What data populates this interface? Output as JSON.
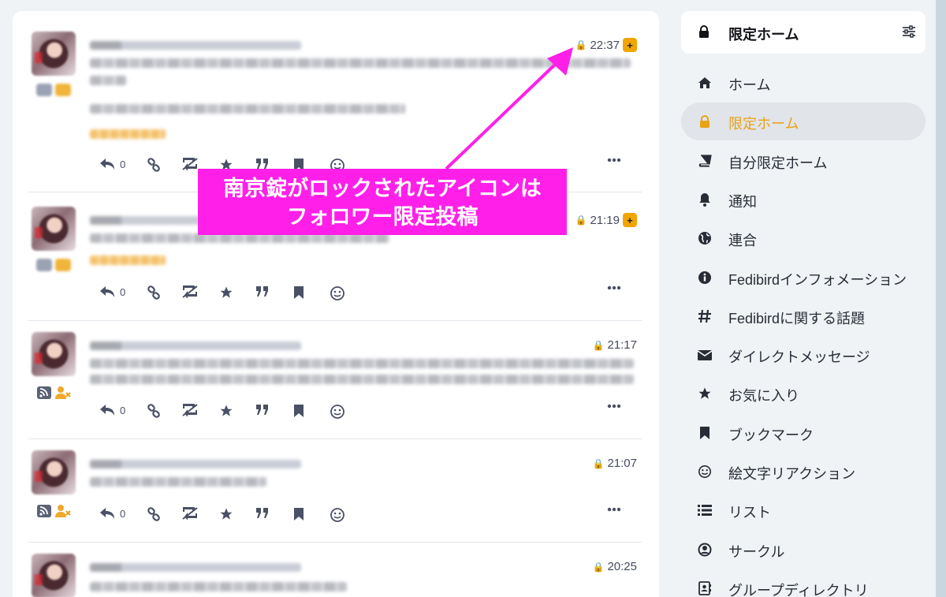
{
  "timeline": {
    "statuses": [
      {
        "time": "22:37",
        "plus_badge": "+",
        "reply_count": "0"
      },
      {
        "time": "21:19",
        "plus_badge": "+",
        "reply_count": "0"
      },
      {
        "time": "21:17",
        "reply_count": "0"
      },
      {
        "time": "21:07",
        "reply_count": "0"
      },
      {
        "time": "20:25"
      }
    ]
  },
  "annotation": {
    "line1": "南京錠がロックされたアイコンは",
    "line2": "フォロワー限定投稿",
    "color": "#ff1fe8"
  },
  "sidebar": {
    "header": {
      "title": "限定ホーム",
      "icon": "lock-icon",
      "settings_icon": "sliders-icon"
    },
    "items": [
      {
        "label": "ホーム",
        "icon": "home-icon"
      },
      {
        "label": "限定ホーム",
        "icon": "lock-icon",
        "active": true
      },
      {
        "label": "自分限定ホーム",
        "icon": "book-icon"
      },
      {
        "label": "通知",
        "icon": "bell-icon"
      },
      {
        "label": "連合",
        "icon": "globe-icon"
      },
      {
        "label": "Fedibirdインフォメーション",
        "icon": "info-icon"
      },
      {
        "label": "Fedibirdに関する話題",
        "icon": "hashtag-icon"
      },
      {
        "label": "ダイレクトメッセージ",
        "icon": "envelope-icon"
      },
      {
        "label": "お気に入り",
        "icon": "star-icon"
      },
      {
        "label": "ブックマーク",
        "icon": "bookmark-icon"
      },
      {
        "label": "絵文字リアクション",
        "icon": "smile-icon"
      },
      {
        "label": "リスト",
        "icon": "list-icon"
      },
      {
        "label": "サークル",
        "icon": "user-circle-icon"
      },
      {
        "label": "グループディレクトリ",
        "icon": "address-book-icon"
      }
    ]
  },
  "colors": {
    "accent": "#e8a317",
    "badge": "#f2a400",
    "icon": "#4a5065"
  }
}
